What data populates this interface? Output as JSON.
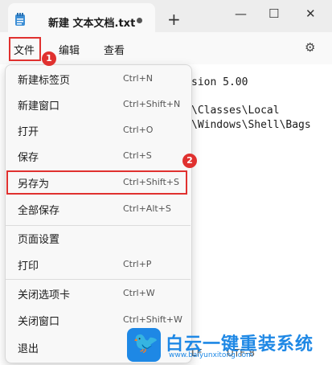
{
  "window": {
    "tab_title": "新建 文本文档.txt",
    "new_tab": "+",
    "minimize": "—",
    "maximize": "☐",
    "close": "✕"
  },
  "menubar": {
    "file": "文件",
    "edit": "编辑",
    "view": "查看"
  },
  "editor": {
    "line1": "sion 5.00",
    "line2": "\\Classes\\Local",
    "line3": "\\Windows\\Shell\\Bags"
  },
  "status": {
    "lf": "LF",
    "encoding": "UTF-8"
  },
  "file_menu": [
    {
      "label": "新建标签页",
      "shortcut": "Ctrl+N"
    },
    {
      "label": "新建窗口",
      "shortcut": "Ctrl+Shift+N"
    },
    {
      "label": "打开",
      "shortcut": "Ctrl+O"
    },
    {
      "label": "保存",
      "shortcut": "Ctrl+S"
    },
    {
      "label": "另存为",
      "shortcut": "Ctrl+Shift+S"
    },
    {
      "label": "全部保存",
      "shortcut": "Ctrl+Alt+S"
    },
    {
      "label": "页面设置",
      "shortcut": ""
    },
    {
      "label": "打印",
      "shortcut": "Ctrl+P"
    },
    {
      "label": "关闭选项卡",
      "shortcut": "Ctrl+W"
    },
    {
      "label": "关闭窗口",
      "shortcut": "Ctrl+Shift+W"
    },
    {
      "label": "退出",
      "shortcut": ""
    }
  ],
  "annotations": {
    "badge1": "1",
    "badge2": "2",
    "highlight_color": "#e0312f"
  },
  "watermark": {
    "title": "白云一键重装系统",
    "url": "www.baiyunxitong.com",
    "bird": "🐦"
  }
}
